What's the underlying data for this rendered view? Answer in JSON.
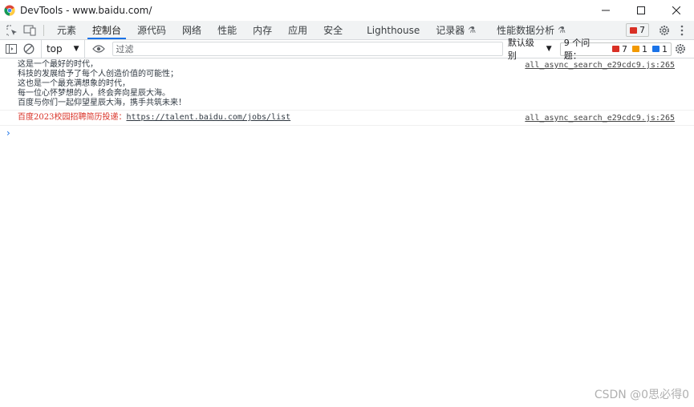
{
  "window": {
    "title": "DevTools - www.baidu.com/",
    "controls": [
      "—",
      "☐",
      "✕"
    ]
  },
  "tabs": [
    {
      "label": "元素"
    },
    {
      "label": "控制台",
      "active": true
    },
    {
      "label": "源代码"
    },
    {
      "label": "网络"
    },
    {
      "label": "性能"
    },
    {
      "label": "内存"
    },
    {
      "label": "应用"
    },
    {
      "label": "安全"
    },
    {
      "label": "Lighthouse"
    },
    {
      "label": "记录器"
    },
    {
      "label": "性能数据分析"
    }
  ],
  "tabbar": {
    "error_count": "7"
  },
  "toolbar": {
    "context": "top",
    "filter_placeholder": "过滤",
    "level": "默认级别",
    "issues_label": "9 个问题：",
    "issues_errors": "7",
    "issues_warnings": "1",
    "issues_info": "1"
  },
  "console": {
    "messages": [
      {
        "lines": [
          "这是一个最好的时代，",
          "科技的发展给予了每个人创造价值的可能性；",
          "这也是一个最充满想象的时代，",
          "每一位心怀梦想的人，终会奔向星辰大海。",
          "百度与你们一起仰望星辰大海，携手共筑未来！"
        ],
        "source": "all_async_search_e29cdc9.js:265"
      },
      {
        "prefix": "百度2023校园招聘简历投递：",
        "link": "https://talent.baidu.com/jobs/list",
        "source": "all_async_search_e29cdc9.js:265"
      }
    ],
    "prompt": "›"
  },
  "watermark": "CSDN @0思必得0",
  "colors": {
    "accent": "#1a73e8",
    "error": "#d93025",
    "warning": "#f29900"
  }
}
